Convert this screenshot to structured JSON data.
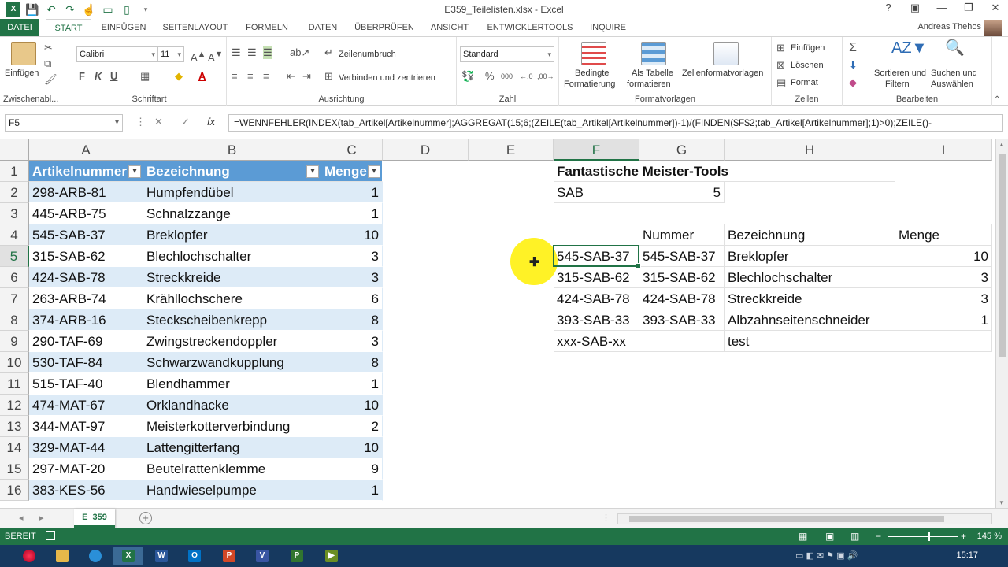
{
  "window": {
    "title": "E359_Teilelisten.xlsx - Excel",
    "help": "?",
    "buttons": [
      "🗗",
      "—",
      "🗗",
      "✕"
    ]
  },
  "ribbon_tabs": {
    "file": "DATEI",
    "items": [
      "START",
      "EINFÜGEN",
      "SEITENLAYOUT",
      "FORMELN",
      "DATEN",
      "ÜBERPRÜFEN",
      "ANSICHT",
      "ENTWICKLERTOOLS",
      "INQUIRE"
    ],
    "active": "START",
    "user": "Andreas Thehos"
  },
  "ribbon": {
    "clipboard": {
      "label": "Zwischenabl...",
      "paste": "Einfügen"
    },
    "font": {
      "label": "Schriftart",
      "name": "Calibri",
      "size": "11",
      "bold": "F",
      "italic": "K",
      "underline": "U"
    },
    "alignment": {
      "label": "Ausrichtung",
      "wrap": "Zeilenumbruch",
      "merge": "Verbinden und zentrieren"
    },
    "number": {
      "label": "Zahl",
      "format": "Standard"
    },
    "styles": {
      "label": "Formatvorlagen",
      "conditional": "Bedingte",
      "conditional2": "Formatierung",
      "table": "Als Tabelle",
      "table2": "formatieren",
      "cellstyles": "Zellenformatvorlagen"
    },
    "cells": {
      "label": "Zellen",
      "insert": "Einfügen",
      "delete": "Löschen",
      "format": "Format"
    },
    "editing": {
      "label": "Bearbeiten",
      "sort": "Sortieren und",
      "sort2": "Filtern",
      "find": "Suchen und",
      "find2": "Auswählen"
    }
  },
  "formula_bar": {
    "name_box": "F5",
    "fx": "fx",
    "formula": "=WENNFEHLER(INDEX(tab_Artikel[Artikelnummer];AGGREGAT(15;6;(ZEILE(tab_Artikel[Artikelnummer])-1)/(FINDEN($F$2;tab_Artikel[Artikelnummer];1)>0);ZEILE()-"
  },
  "grid": {
    "columns": [
      "A",
      "B",
      "C",
      "D",
      "E",
      "F",
      "G",
      "H",
      "I"
    ],
    "rows": [
      "1",
      "2",
      "3",
      "4",
      "5",
      "6",
      "7",
      "8",
      "9",
      "10",
      "11",
      "12",
      "13",
      "14",
      "15",
      "16"
    ],
    "selected_column": "F",
    "selected_row": "5",
    "table_headers": [
      "Artikelnummer",
      "Bezeichnung",
      "Menge"
    ],
    "table_rows": [
      [
        "298-ARB-81",
        "Humpfendübel",
        "1"
      ],
      [
        "445-ARB-75",
        "Schnalzzange",
        "1"
      ],
      [
        "545-SAB-37",
        "Breklopfer",
        "10"
      ],
      [
        "315-SAB-62",
        "Blechlochschalter",
        "3"
      ],
      [
        "424-SAB-78",
        "Streckkreide",
        "3"
      ],
      [
        "263-ARB-74",
        "Krähllochschere",
        "6"
      ],
      [
        "374-ARB-16",
        "Steckscheibenkrepp",
        "8"
      ],
      [
        "290-TAF-69",
        "Zwingstreckendoppler",
        "3"
      ],
      [
        "530-TAF-84",
        "Schwarzwandkupplung",
        "8"
      ],
      [
        "515-TAF-40",
        "Blendhammer",
        "1"
      ],
      [
        "474-MAT-67",
        "Orklandhacke",
        "10"
      ],
      [
        "344-MAT-97",
        "Meisterkotterverbindung",
        "2"
      ],
      [
        "329-MAT-44",
        "Lattengitterfang",
        "10"
      ],
      [
        "297-MAT-20",
        "Beutelrattenklemme",
        "9"
      ],
      [
        "383-KES-56",
        "Handwieselpumpe",
        "1"
      ]
    ],
    "tool_title": "Fantastische Meister-Tools",
    "search_term": "SAB",
    "search_count": "5",
    "result_headers": [
      "Nummer",
      "Bezeichnung",
      "Menge"
    ],
    "results": [
      [
        "545-SAB-37",
        "545-SAB-37",
        "Breklopfer",
        "10"
      ],
      [
        "315-SAB-62",
        "315-SAB-62",
        "Blechlochschalter",
        "3"
      ],
      [
        "424-SAB-78",
        "424-SAB-78",
        "Streckkreide",
        "3"
      ],
      [
        "393-SAB-33",
        "393-SAB-33",
        "Albzahnseitenschneider",
        "1"
      ],
      [
        "xxx-SAB-xx",
        "",
        "test",
        ""
      ]
    ]
  },
  "sheets": {
    "active": "E_359",
    "add": "+"
  },
  "status": {
    "ready": "BEREIT",
    "zoom": "145 %"
  },
  "taskbar": {
    "clock": "15:17"
  }
}
